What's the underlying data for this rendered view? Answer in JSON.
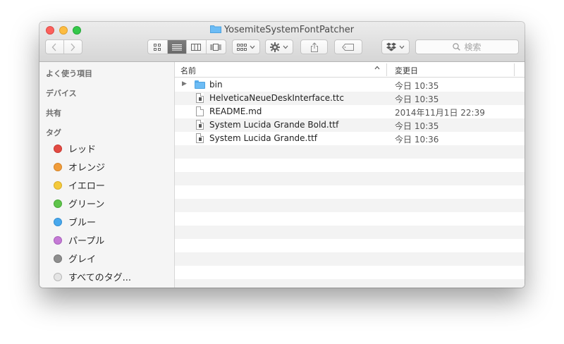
{
  "window": {
    "title": "YosemiteSystemFontPatcher"
  },
  "toolbar": {
    "search_placeholder": "検索"
  },
  "sidebar": {
    "favorites_header": "よく使う項目",
    "devices_header": "デバイス",
    "shared_header": "共有",
    "tags_header": "タグ",
    "tags": [
      {
        "label": "レッド",
        "color": "#e24b43"
      },
      {
        "label": "オレンジ",
        "color": "#f09c3a"
      },
      {
        "label": "イエロー",
        "color": "#f4c93b"
      },
      {
        "label": "グリーン",
        "color": "#5fc44b"
      },
      {
        "label": "ブルー",
        "color": "#48a8ec"
      },
      {
        "label": "パープル",
        "color": "#c57ad6"
      },
      {
        "label": "グレイ",
        "color": "#8e8e8e"
      },
      {
        "label": "すべてのタグ...",
        "color": "#d8d8d8"
      }
    ]
  },
  "list": {
    "col_name": "名前",
    "col_date": "変更日",
    "rows": [
      {
        "name": "bin",
        "date": "今日 10:35",
        "kind": "folder"
      },
      {
        "name": "HelveticaNeueDeskInterface.ttc",
        "date": "今日 10:35",
        "kind": "font"
      },
      {
        "name": "README.md",
        "date": "2014年11月1日 22:39",
        "kind": "doc"
      },
      {
        "name": "System Lucida Grande Bold.ttf",
        "date": "今日 10:35",
        "kind": "font"
      },
      {
        "name": "System Lucida Grande.ttf",
        "date": "今日 10:36",
        "kind": "font"
      }
    ]
  }
}
